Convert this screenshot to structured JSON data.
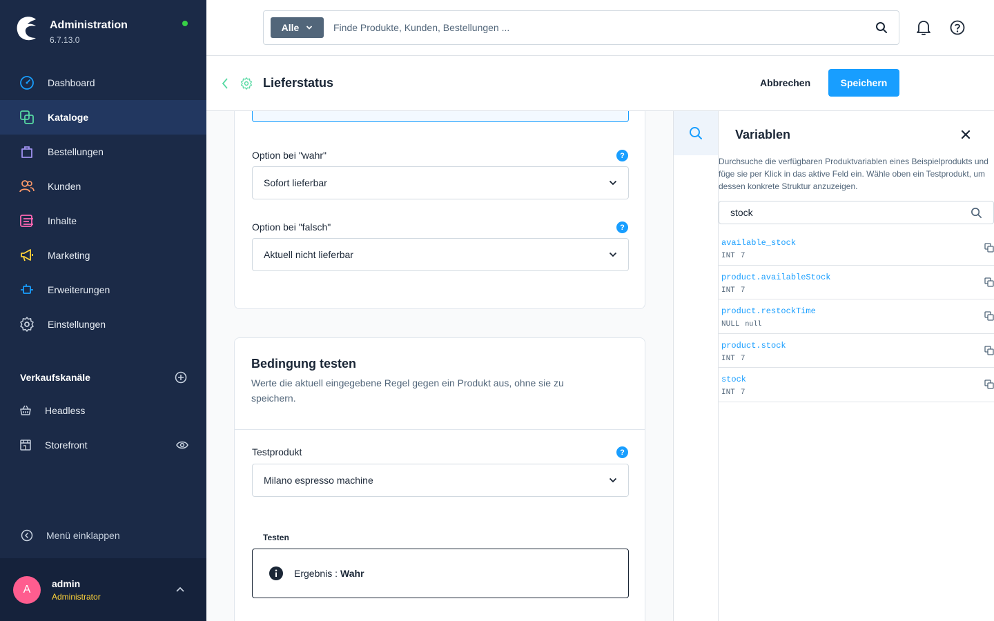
{
  "app": {
    "title": "Administration",
    "version": "6.7.13.0"
  },
  "sidebar": {
    "items": [
      {
        "label": "Dashboard",
        "icon": "dashboard-icon"
      },
      {
        "label": "Kataloge",
        "icon": "catalog-icon",
        "active": true
      },
      {
        "label": "Bestellungen",
        "icon": "shopping-bag-icon"
      },
      {
        "label": "Kunden",
        "icon": "customers-icon"
      },
      {
        "label": "Inhalte",
        "icon": "content-icon"
      },
      {
        "label": "Marketing",
        "icon": "megaphone-icon"
      },
      {
        "label": "Erweiterungen",
        "icon": "plug-icon"
      },
      {
        "label": "Einstellungen",
        "icon": "gear-icon"
      }
    ],
    "sales_channels_title": "Verkaufskanäle",
    "sales_channels": [
      {
        "label": "Headless",
        "icon": "basket-icon"
      },
      {
        "label": "Storefront",
        "icon": "storefront-icon"
      }
    ],
    "collapse_label": "Menü einklappen"
  },
  "user": {
    "initial": "A",
    "name": "admin",
    "role": "Administrator"
  },
  "search": {
    "type_label": "Alle",
    "placeholder": "Finde Produkte, Kunden, Bestellungen ..."
  },
  "header": {
    "title": "Lieferstatus",
    "cancel_label": "Abbrechen",
    "save_label": "Speichern"
  },
  "form": {
    "code_snippet": "%}",
    "option_true_label": "Option bei \"wahr\"",
    "option_true_value": "Sofort lieferbar",
    "option_false_label": "Option bei \"falsch\"",
    "option_false_value": "Aktuell nicht lieferbar",
    "help_symbol": "?"
  },
  "test": {
    "title": "Bedingung testen",
    "description": "Werte die aktuell eingegebene Regel gegen ein Produkt aus, ohne sie zu speichern.",
    "product_label": "Testprodukt",
    "product_value": "Milano espresso machine",
    "test_label": "Testen",
    "result_label": "Ergebnis :",
    "result_value": "Wahr"
  },
  "variables": {
    "title": "Variablen",
    "description": "Durchsuche die verfügbaren Produktvariablen eines Beispielprodukts und füge sie per Klick in das aktive Feld ein. Wähle oben ein Testprodukt, um dessen konkrete Struktur anzuzeigen.",
    "search_value": "stock",
    "items": [
      {
        "name": "available_stock",
        "type": "INT",
        "value": "7"
      },
      {
        "name": "product.availableStock",
        "type": "INT",
        "value": "7"
      },
      {
        "name": "product.restockTime",
        "type": "NULL",
        "value": "null"
      },
      {
        "name": "product.stock",
        "type": "INT",
        "value": "7"
      },
      {
        "name": "stock",
        "type": "INT",
        "value": "7"
      }
    ]
  },
  "colors": {
    "sidebar_bg": "#1b2a47",
    "accent": "#189eff",
    "status_online": "#37d046",
    "avatar": "#ff5d8f",
    "role": "#ffd439"
  }
}
